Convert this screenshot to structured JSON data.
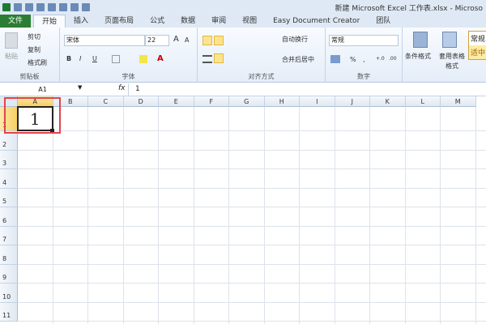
{
  "window": {
    "title": "新建 Microsoft Excel 工作表.xlsx - Microso"
  },
  "tabs": [
    "文件",
    "开始",
    "插入",
    "页面布局",
    "公式",
    "数据",
    "审阅",
    "视图",
    "Easy Document Creator",
    "团队"
  ],
  "clipboard": {
    "paste": "粘贴",
    "cut": "剪切",
    "copy": "复制",
    "format_painter": "格式刷",
    "label": "剪贴板"
  },
  "font": {
    "name": "宋体",
    "size": "22",
    "bold": "B",
    "italic": "I",
    "underline": "U",
    "label": "字体",
    "grow": "A",
    "shrink": "A",
    "font_color": "A"
  },
  "alignment": {
    "wrap": "自动换行",
    "merge": "合并后居中",
    "label": "对齐方式"
  },
  "number": {
    "format": "常规",
    "percent": "%",
    "comma": ",",
    "inc_dec": "+.0",
    "dec_dec": ".00",
    "label": "数字"
  },
  "styles": {
    "conditional": "条件格式",
    "table": "套用表格格式",
    "normal": "常规",
    "neutral": "适中"
  },
  "formula_bar": {
    "name_box": "A1",
    "fx": "fx",
    "value": "1"
  },
  "columns": [
    "A",
    "B",
    "C",
    "D",
    "E",
    "F",
    "G",
    "H",
    "I",
    "J",
    "K",
    "L",
    "M"
  ],
  "rows": [
    "1",
    "2",
    "3",
    "4",
    "5",
    "6",
    "7",
    "8",
    "9",
    "10",
    "11"
  ],
  "cells": {
    "A1": "1"
  }
}
